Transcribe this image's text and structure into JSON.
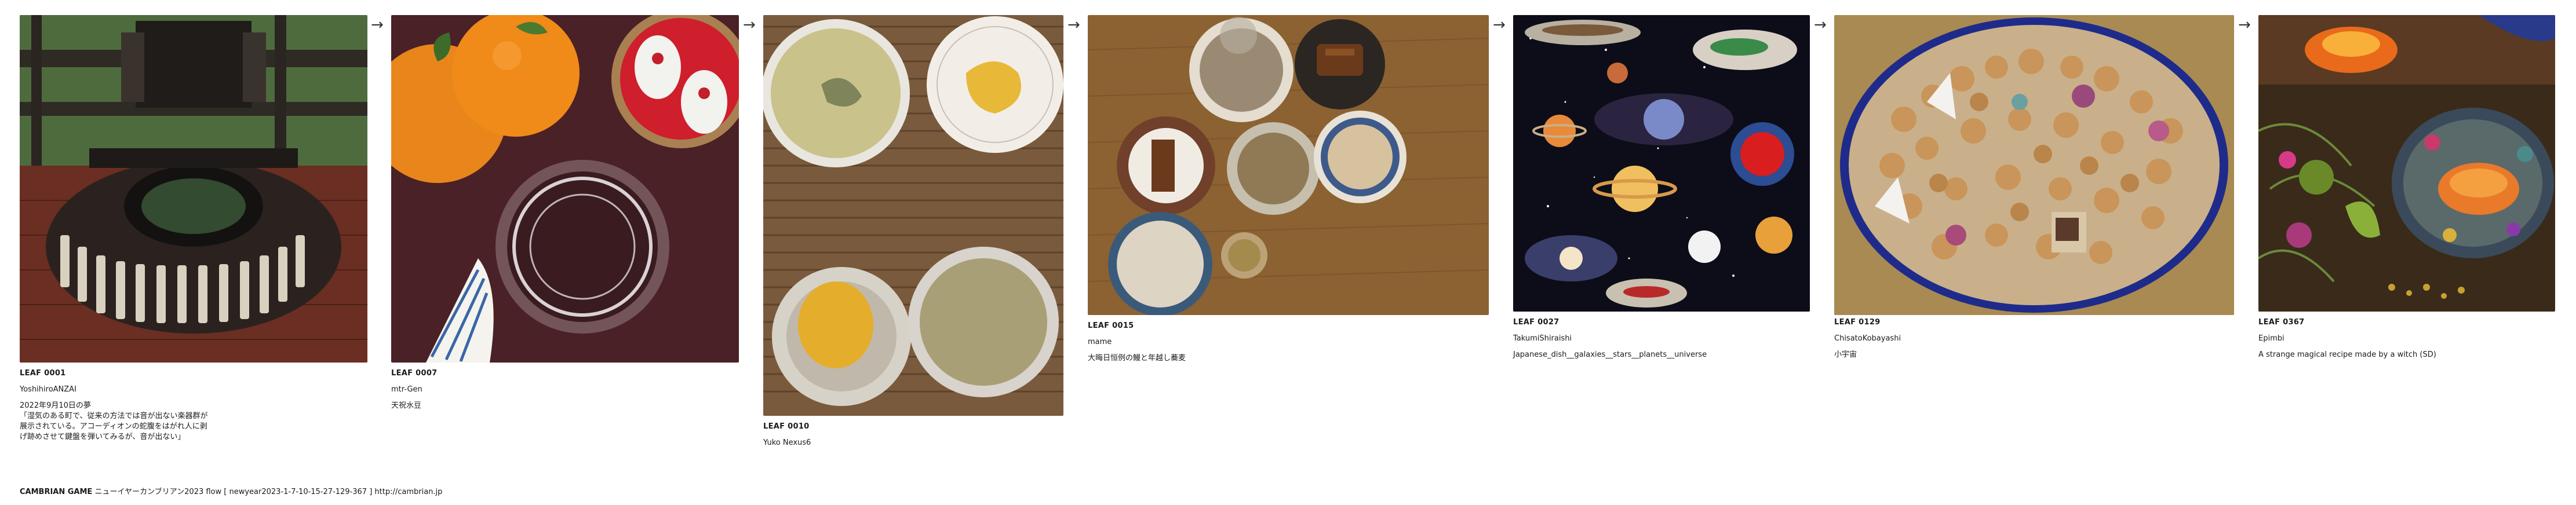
{
  "arrow_glyph": "→",
  "leaves": [
    {
      "id": "LEAF 0001",
      "author": "YoshihiroANZAI",
      "title": "2022年9月10日の夢",
      "description": "「湿気のある町で、従来の方法では音が出ない楽器群が\n展示されている。アコーディオンの蛇腹をはがれ人に剥\nげ跡めさせて鍵盤を弾いてみるが、音が出ない」",
      "image_icon": "accordion-instrument-image"
    },
    {
      "id": "LEAF 0007",
      "author": "mtr-Gen",
      "title": "天祝水豆",
      "description": "",
      "image_icon": "oranges-and-glass-image"
    },
    {
      "id": "LEAF 0010",
      "author": "Yuko Nexus6",
      "title": "",
      "description": "",
      "image_icon": "tea-and-sweets-image"
    },
    {
      "id": "LEAF 0015",
      "author": "mame",
      "title": "大晦日恒例の鰻と年越し蕎麦",
      "description": "",
      "image_icon": "table-dishes-image"
    },
    {
      "id": "LEAF 0027",
      "author": "TakumiShiraishi",
      "title": "Japanese_dish__galaxies__stars__planets__universe",
      "description": "",
      "image_icon": "cosmic-dishes-image"
    },
    {
      "id": "LEAF 0129",
      "author": "ChisatoKobayashi",
      "title": "小宇宙",
      "description": "",
      "image_icon": "cookie-bowl-image"
    },
    {
      "id": "LEAF 0367",
      "author": "Epimbi",
      "title": "A strange magical recipe made by a witch   (SD)",
      "description": "",
      "image_icon": "magical-recipe-image"
    }
  ],
  "footer": {
    "brand": "CAMBRIAN GAME",
    "text": "ニューイヤーカンブリアン2023  flow [ newyear2023-1-7-10-15-27-129-367 ]    http://cambrian.jp"
  }
}
